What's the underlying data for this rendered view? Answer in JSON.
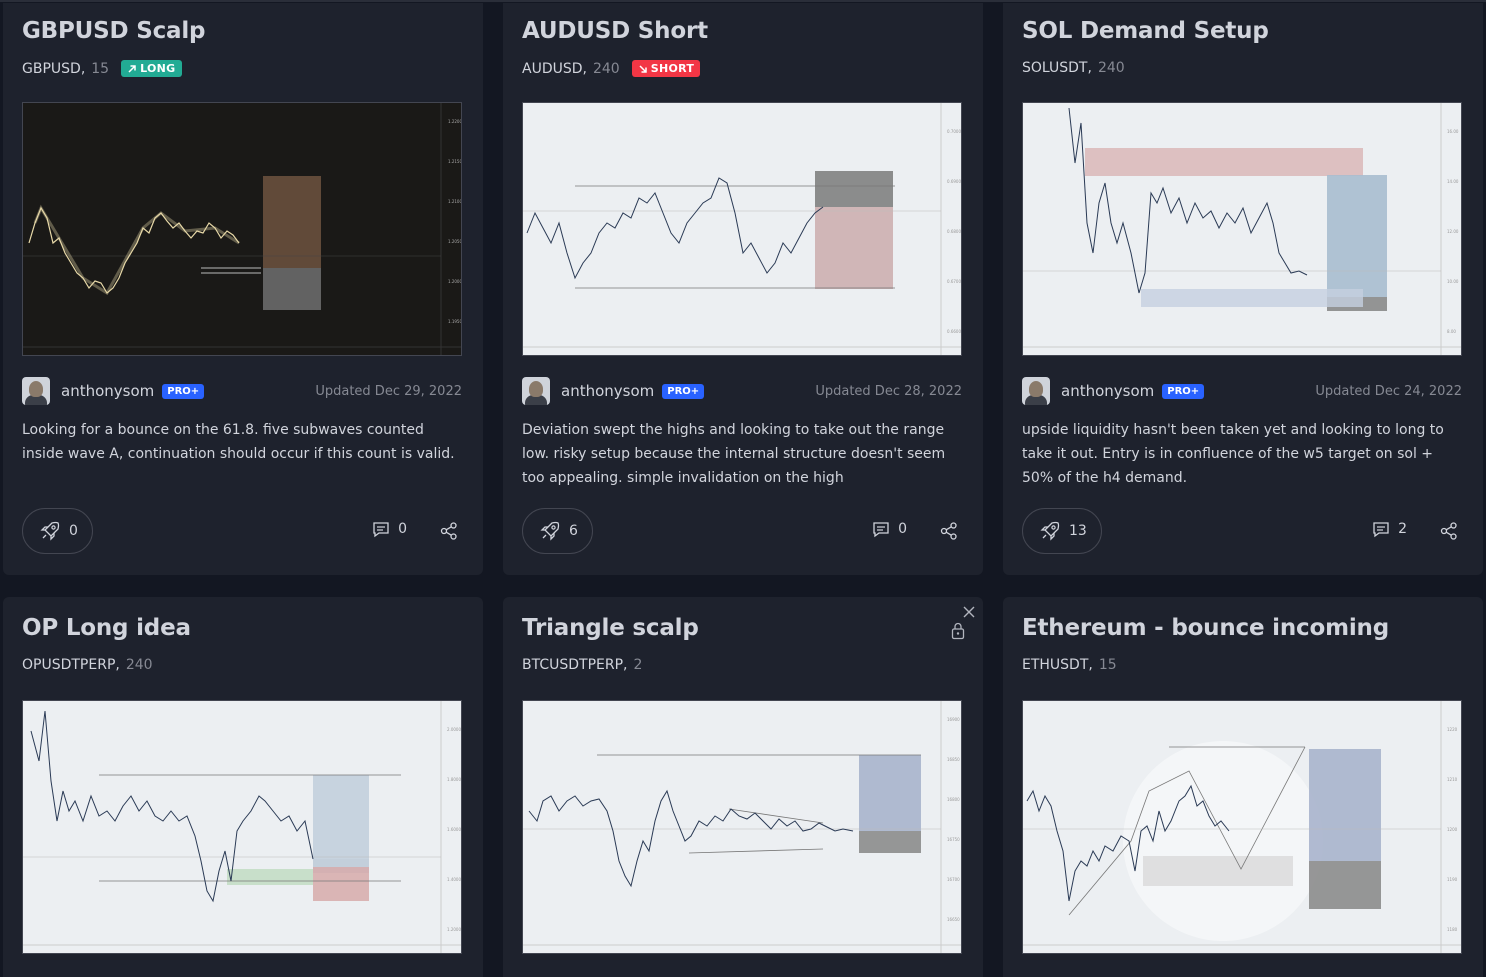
{
  "cards": [
    {
      "title": "GBPUSD Scalp",
      "symbol": "GBPUSD",
      "timeframe": "15",
      "direction": "LONG",
      "author": "anthonysom",
      "plan": "PRO+",
      "updated": "Updated Dec 29, 2022",
      "description": "Looking for a bounce on the 61.8. five subwaves counted inside wave A, continuation should occur if this count is valid.",
      "boosts": "0",
      "comments": "0"
    },
    {
      "title": "AUDUSD Short",
      "symbol": "AUDUSD",
      "timeframe": "240",
      "direction": "SHORT",
      "author": "anthonysom",
      "plan": "PRO+",
      "updated": "Updated Dec 28, 2022",
      "description": "Deviation swept the highs and looking to take out the range low. risky setup because the internal structure doesn't seem too appealing. simple invalidation on the high",
      "boosts": "6",
      "comments": "0"
    },
    {
      "title": "SOL Demand Setup",
      "symbol": "SOLUSDT",
      "timeframe": "240",
      "direction": "",
      "author": "anthonysom",
      "plan": "PRO+",
      "updated": "Updated Dec 24, 2022",
      "description": "upside liquidity hasn't been taken yet and looking to long to take it out. Entry is in confluence of the w5 target on sol + 50% of the h4 demand.",
      "boosts": "13",
      "comments": "2"
    },
    {
      "title": "OP Long idea",
      "symbol": "OPUSDTPERP",
      "timeframe": "240"
    },
    {
      "title": "Triangle scalp",
      "symbol": "BTCUSDTPERP",
      "timeframe": "2"
    },
    {
      "title": "Ethereum - bounce incoming",
      "symbol": "ETHUSDT",
      "timeframe": "15"
    }
  ],
  "icons": {
    "boost": "rocket-icon",
    "comment": "comment-icon",
    "share": "share-icon",
    "long": "arrow-up-right-icon",
    "short": "arrow-down-right-icon",
    "close": "close-icon",
    "lock": "lock-icon"
  },
  "colors": {
    "background": "#131722",
    "card": "#1e222d",
    "long": "#22ab94",
    "short": "#f23645",
    "pro": "#2962ff"
  }
}
